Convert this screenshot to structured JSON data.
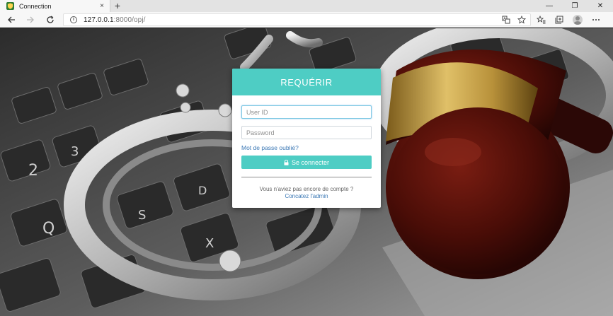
{
  "browser": {
    "tab": {
      "title": "Connection",
      "close": "×"
    },
    "new_tab": "+",
    "window": {
      "minimize": "—",
      "restore": "❐",
      "close": "✕"
    },
    "url_host": "127.0.0.1",
    "url_rest": ":8000/opj/"
  },
  "login": {
    "title": "REQUÉRIR",
    "user_placeholder": "User ID",
    "password_placeholder": "Password",
    "forgot": "Mot de passe oublié?",
    "submit": "Se connecter",
    "no_account": "Vous n'aviez pas encore de compte ?",
    "contact": "Concatez l'admin"
  },
  "icons": {
    "favicon": "shield-icon",
    "back": "back-arrow-icon",
    "forward": "forward-arrow-icon",
    "refresh": "refresh-icon",
    "info": "info-icon",
    "translate": "translate-icon",
    "favorite": "star-icon",
    "favorites": "favorites-icon",
    "collections": "collections-icon",
    "profile": "profile-icon",
    "menu": "more-icon",
    "lock": "lock-icon"
  },
  "colors": {
    "accent": "#4ecdc4",
    "link": "#3b78b5"
  }
}
